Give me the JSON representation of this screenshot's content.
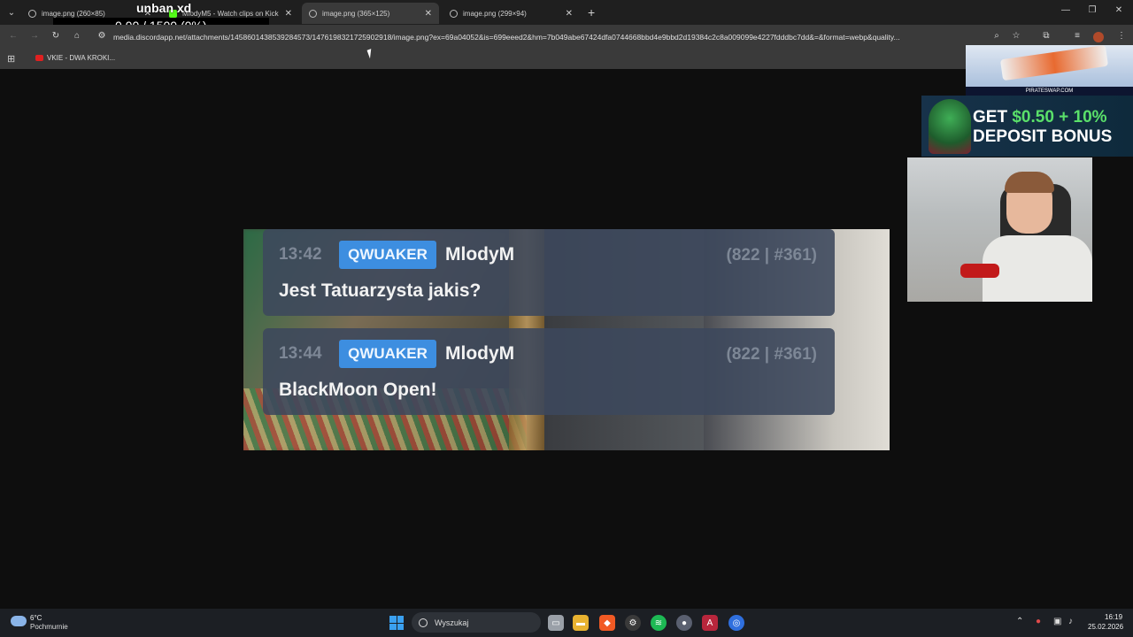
{
  "browser": {
    "tabs": [
      {
        "title": "image.png (260×85)",
        "active": false
      },
      {
        "title": "MlodyM5 - Watch clips on Kick",
        "active": false
      },
      {
        "title": "image.png (365×125)",
        "active": true
      },
      {
        "title": "image.png (299×94)",
        "active": false
      }
    ],
    "new_tab": "+",
    "url": "media.discordapp.net/attachments/1458601438539284573/1476198321725902918/image.png?ex=69a04052&is=699eeed2&hm=7b049abe67424dfa0744668bbd4e9bbd2d19384c2c8a009099e4227fdddbc7dd&=&format=webp&quality...",
    "bookmarks": [
      {
        "label": "VKIE - DWA KROKI..."
      }
    ]
  },
  "overlay": {
    "title": "unban xd",
    "progress_text": "0.00 / 1500 (0%)",
    "progress_fraction": 0.0
  },
  "chat": {
    "messages": [
      {
        "time": "13:42",
        "tag": "QWUAKER",
        "user": "MlodyM",
        "stat": "(822 | #361)",
        "text": "Jest Tatuarzysta jakis?"
      },
      {
        "time": "13:44",
        "tag": "QWUAKER",
        "user": "MlodyM",
        "stat": "(822 | #361)",
        "text": "BlackMoon Open!"
      }
    ]
  },
  "ads": {
    "brand": "PIRATESWAP.COM",
    "banner_line1_prefix": "GET ",
    "banner_amount": "$0.50 + 10%",
    "banner_line2": "DEPOSIT BONUS"
  },
  "taskbar": {
    "weather_temp": "6°C",
    "weather_desc": "Pochmurnie",
    "search_label": "Wyszukaj",
    "time": "16:19",
    "date": "25.02.2026"
  },
  "colors": {
    "tag_blue": "#3d8ee0",
    "message_bg": "#3c485c",
    "kick_green": "#53fc18",
    "accent_green": "#5ae06a"
  }
}
